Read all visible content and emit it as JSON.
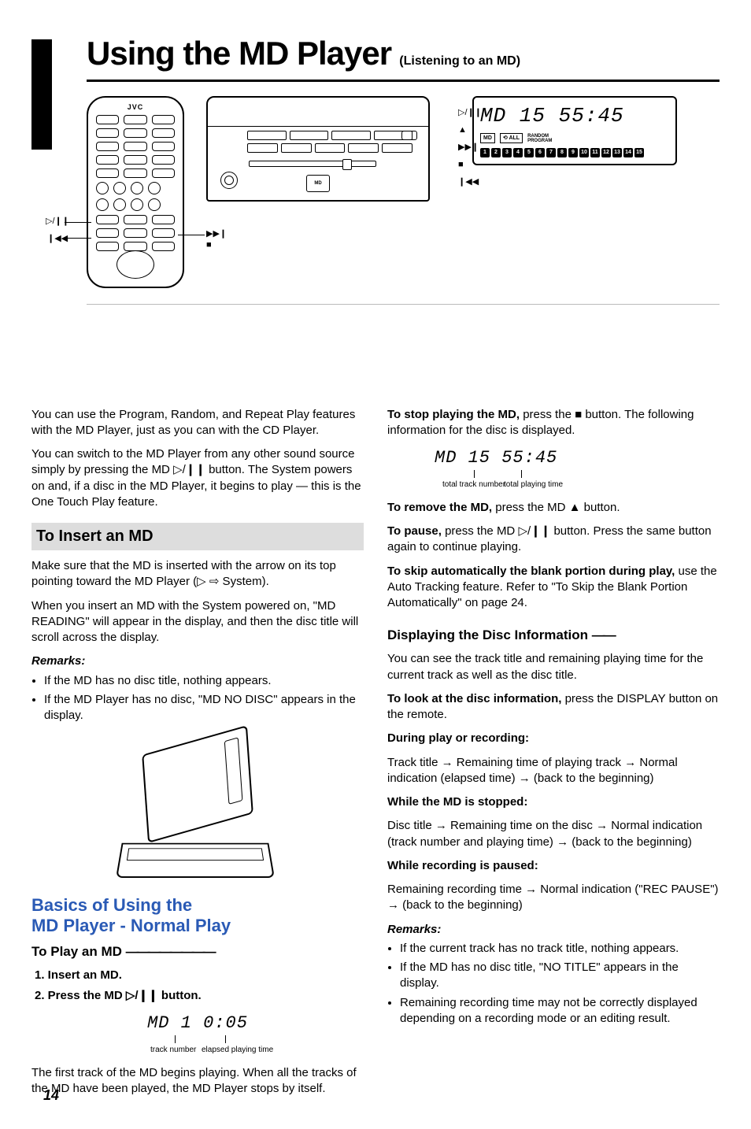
{
  "page_number": "14",
  "title": {
    "main": "Using the MD Player",
    "sub": "(Listening to an MD)"
  },
  "remote_brand": "JVC",
  "remote_symbols": {
    "play_pause": "▷/❙❙",
    "prev": "❙◀◀",
    "next": "▶▶❙",
    "stop": "■"
  },
  "deck_symbols": {
    "play_pause": "▷/❙❙",
    "eject": "▲",
    "next": "▶▶❙",
    "stop": "■",
    "prev": "❙◀◀"
  },
  "lcd": {
    "main_line": "MD  15  55:45",
    "tags": {
      "md": "MD",
      "repeat_all": "⟲ ALL",
      "stack": [
        "RANDOM",
        "PROGRAM"
      ]
    },
    "track_boxes": [
      "1",
      "2",
      "3",
      "4",
      "5",
      "6",
      "7",
      "8",
      "9",
      "10",
      "11",
      "12",
      "13",
      "14",
      "15"
    ]
  },
  "intro": {
    "p1": "You can use the Program, Random, and Repeat Play features with the MD Player, just as you can with the CD Player.",
    "p2_a": "You can switch to the MD Player from any other sound source simply by pressing the MD ",
    "p2_sym": "▷/❙❙",
    "p2_b": " button. The System powers on and, if a disc in the MD Player, it begins to play — this is the One Touch Play feature."
  },
  "insert": {
    "heading": "To Insert an MD",
    "p1_a": "Make sure that the MD is inserted with the arrow on its top pointing toward the MD Player (",
    "p1_sym": "▷ ⇨",
    "p1_b": " System).",
    "p2_a": "When you insert an MD with the System powered on, ",
    "p2_q": "\"MD READING\"",
    "p2_b": " will appear in the display, and then the disc title will scroll across the display.",
    "remarks_title": "Remarks:",
    "r1": "If the MD has no disc title, nothing appears.",
    "r2": "If the MD Player has no disc, \"MD NO DISC\" appears in the display."
  },
  "basics": {
    "heading_l1": "Basics of Using the",
    "heading_l2": "MD Player - Normal Play",
    "play_sub": "To Play an MD",
    "dash": "————————",
    "step1": "1. Insert an MD.",
    "step2_a": "2. Press the MD ",
    "step2_sym": "▷/❙❙",
    "step2_b": " button.",
    "seg": "MD   1   0:05",
    "anno1": "track number",
    "anno2": "elapsed playing time",
    "after": "The first track of the MD begins playing. When all the tracks of the MD have been played, the MD Player stops by itself."
  },
  "right": {
    "stop_a": "To stop playing the MD,",
    "stop_sym": "■",
    "stop_b": " button. The following information for the disc is displayed.",
    "stop_seg": "MD 15 55:45",
    "anno_total": "total track number",
    "anno_time": "total playing time",
    "eject_a": "To remove the MD,",
    "eject_b": " press the MD ",
    "eject_sym": "▲",
    "eject_c": " button.",
    "pause_a": "To pause,",
    "pause_b": " press the MD ",
    "pause_sym": "▷/❙❙",
    "pause_c": " button. Press the same button again to continue playing.",
    "auto_a": "To skip automatically the blank portion during play,",
    "auto_b": " use the Auto Tracking feature. Refer to \"To Skip the Blank Portion Automatically\" on page 24.",
    "disc_info_heading": "Displaying the Disc Information",
    "disc_info_dash": "——",
    "di_p": "You can see the track title and remaining playing time for the current track as well as the disc title.",
    "di_look": "To look at the disc information,",
    "di_look_b": " press the DISPLAY button on the remote.",
    "di_play": "During play or recording:",
    "di_seq_play": "Track title → Remaining time of playing track → Normal indication (elapsed time) → (back to the beginning)",
    "di_stop": "While the MD is stopped:",
    "di_seq_stop": "Disc title → Remaining time on the disc → Normal indication (track number and playing time) → (back to the beginning)",
    "di_rec": "While recording is paused:",
    "di_seq_rec": "Remaining recording time → Normal indication (\"REC PAUSE\") → (back to the beginning)",
    "remarks_title": "Remarks:",
    "rm1": "If the current track has no track title, nothing appears.",
    "rm2": "If the MD has no disc title, \"NO TITLE\" appears in the display.",
    "rm3": "Remaining recording time may not be correctly displayed depending on a recording mode or an editing result."
  }
}
